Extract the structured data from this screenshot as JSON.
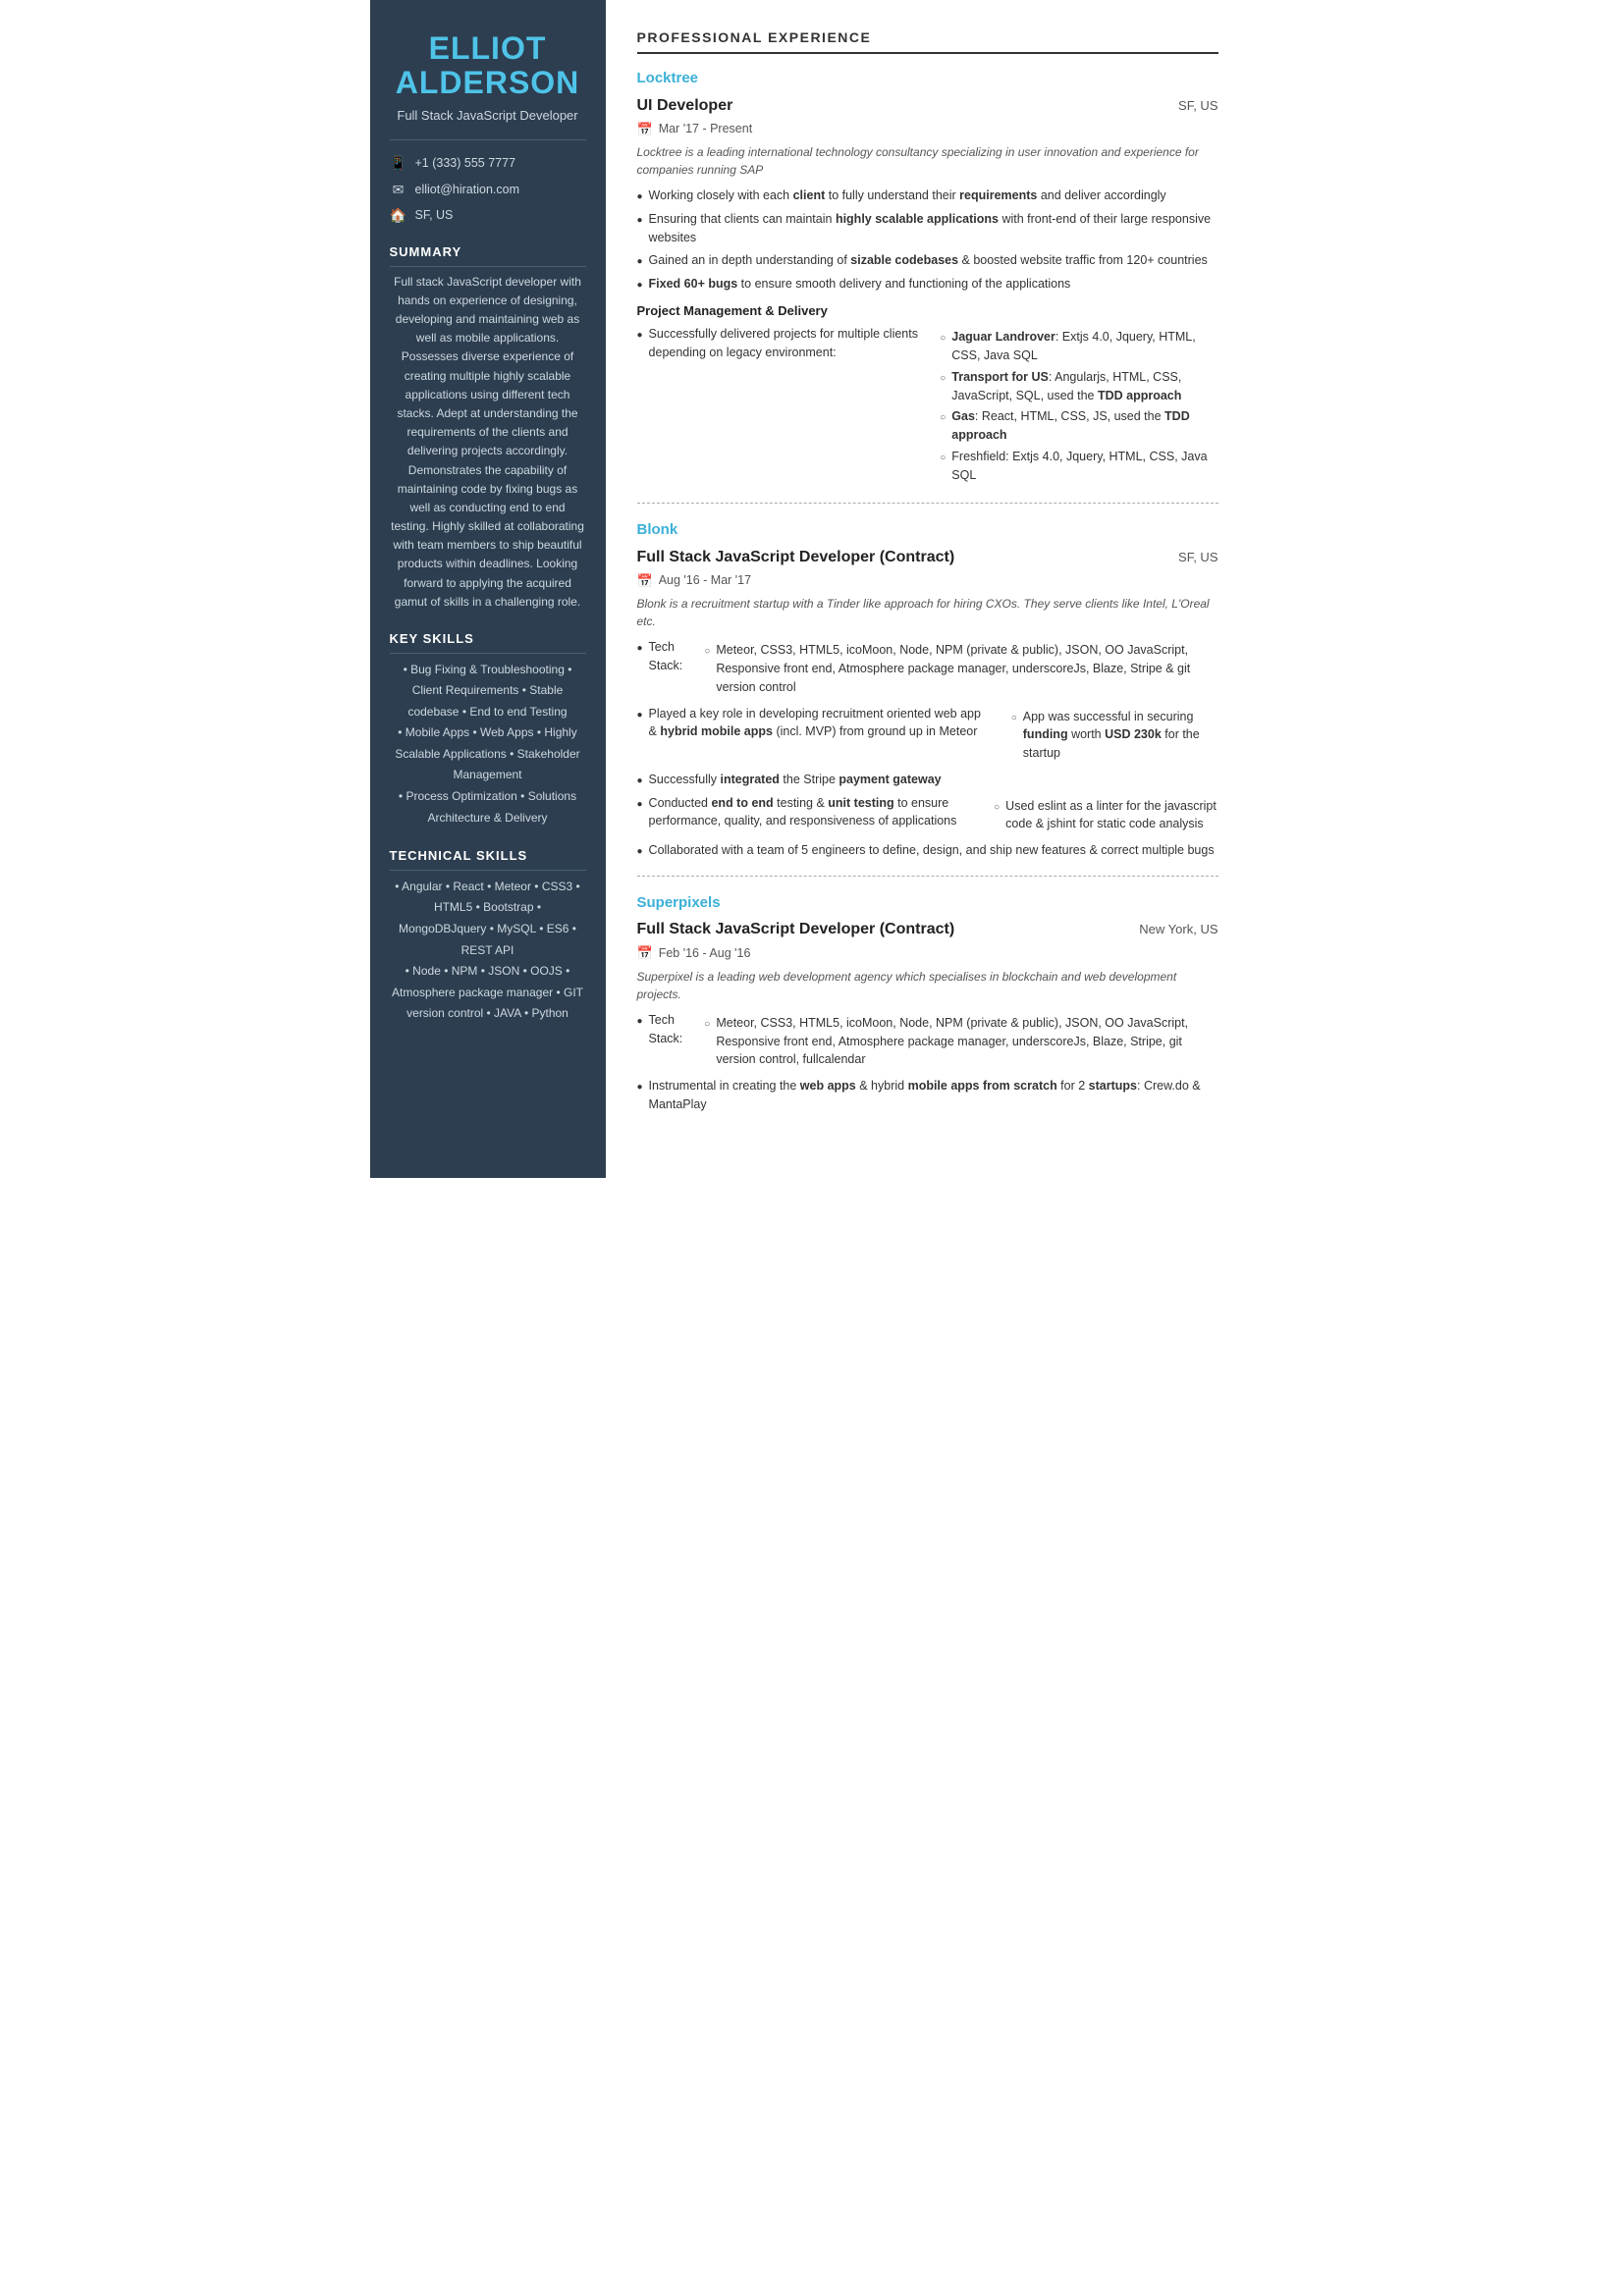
{
  "sidebar": {
    "name_line1": "ELLIOT",
    "name_line2": "ALDERSON",
    "title": "Full Stack JavaScript Developer",
    "contact": {
      "phone_icon": "📱",
      "phone": "+1 (333) 555 7777",
      "email_icon": "✉",
      "email": "elliot@hiration.com",
      "location_icon": "🏠",
      "location": "SF, US"
    },
    "summary_title": "SUMMARY",
    "summary_text": "Full stack JavaScript developer with hands on experience of designing, developing and maintaining web as well as mobile applications. Possesses diverse experience of creating multiple highly scalable applications using different tech stacks. Adept at understanding the requirements of the clients and delivering projects accordingly. Demonstrates the capability of maintaining code by fixing bugs as well as conducting end to end testing. Highly skilled at collaborating with team members to ship beautiful products within deadlines. Looking forward to applying the acquired gamut of skills in a challenging role.",
    "key_skills_title": "KEY SKILLS",
    "key_skills_text": "• Bug Fixing & Troubleshooting • Client Requirements • Stable codebase • End to end Testing\n• Mobile Apps • Web Apps • Highly Scalable Applications • Stakeholder Management\n• Process Optimization • Solutions Architecture & Delivery",
    "tech_skills_title": "TECHNICAL SKILLS",
    "tech_skills_text": "• Angular • React • Meteor • CSS3 • HTML5 • Bootstrap • MongoDBJquery • MySQL • ES6 • REST API\n• Node • NPM • JSON • OOJS • Atmosphere package manager • GIT version control • JAVA • Python"
  },
  "main": {
    "section_title": "PROFESSIONAL EXPERIENCE",
    "jobs": [
      {
        "company": "Locktree",
        "title": "UI Developer",
        "location": "SF, US",
        "date": "Mar '17 -  Present",
        "description": "Locktree is a leading international technology consultancy specializing in user innovation and experience for companies running SAP",
        "bullets": [
          {
            "text": "Working closely with each <b>client</b> to fully understand their <b>requirements</b> and deliver accordingly",
            "sub": []
          },
          {
            "text": "Ensuring that clients can maintain <b>highly scalable applications</b> with front-end of their large responsive websites",
            "sub": []
          },
          {
            "text": "Gained an in depth understanding of <b>sizable codebases</b> & boosted website traffic from 120+ countries",
            "sub": []
          },
          {
            "text": "<b>Fixed 60+ bugs</b> to ensure smooth delivery and functioning of the applications",
            "sub": []
          }
        ],
        "subsections": [
          {
            "title": "Project Management & Delivery",
            "bullets": [
              {
                "text": "Successfully delivered projects for multiple clients depending on legacy environment:",
                "sub": [
                  "<b>Jaguar Landrover</b>: Extjs 4.0, Jquery, HTML, CSS, Java SQL",
                  "<b>Transport for US</b>: Angularjs, HTML, CSS, JavaScript, SQL, used the <b>TDD approach</b>",
                  "<b>Gas</b>: React, HTML, CSS, JS, used the <b>TDD approach</b>",
                  "Freshfield: Extjs 4.0, Jquery, HTML, CSS, Java SQL"
                ]
              }
            ]
          }
        ]
      },
      {
        "company": "Blonk",
        "title": "Full Stack JavaScript Developer (Contract)",
        "location": "SF, US",
        "date": "Aug '16 -  Mar '17",
        "description": "Blonk is a recruitment startup with a Tinder like approach for hiring CXOs. They serve clients like Intel, L'Oreal etc.",
        "bullets": [
          {
            "text": "Tech Stack:",
            "sub": [
              "Meteor, CSS3, HTML5, icoMoon, Node, NPM (private & public), JSON, OO JavaScript, Responsive front end, Atmosphere package manager, underscoreJs, Blaze, Stripe & git version control"
            ]
          },
          {
            "text": "Played a key role in developing recruitment oriented web app & <b>hybrid mobile apps</b> (incl. MVP) from ground up in Meteor",
            "sub": [
              "App was successful in securing <b>funding</b> worth <b>USD 230k</b> for the startup"
            ]
          },
          {
            "text": "Successfully <b>integrated</b> the Stripe <b>payment gateway</b>",
            "sub": []
          },
          {
            "text": "Conducted <b>end to end</b> testing & <b>unit testing</b> to ensure performance, quality, and responsiveness of applications",
            "sub": [
              "Used eslint as a linter for the javascript code & jshint for static code analysis"
            ]
          },
          {
            "text": "Collaborated with a team of 5 engineers to define, design, and ship new features & correct multiple bugs",
            "sub": []
          }
        ],
        "subsections": []
      },
      {
        "company": "Superpixels",
        "title": "Full Stack JavaScript Developer (Contract)",
        "location": "New York, US",
        "date": "Feb '16 -  Aug '16",
        "description": "Superpixel is a leading web development agency which specialises in blockchain and web development projects.",
        "bullets": [
          {
            "text": "Tech Stack:",
            "sub": [
              "Meteor, CSS3, HTML5, icoMoon, Node, NPM (private & public), JSON, OO JavaScript, Responsive front end, Atmosphere package manager, underscoreJs, Blaze, Stripe, git version control, fullcalendar"
            ]
          },
          {
            "text": "Instrumental in creating the <b>web apps</b> & hybrid <b>mobile apps from scratch</b> for 2 <b>startups</b>: Crew.do & MantaPlay",
            "sub": []
          }
        ],
        "subsections": []
      }
    ]
  }
}
